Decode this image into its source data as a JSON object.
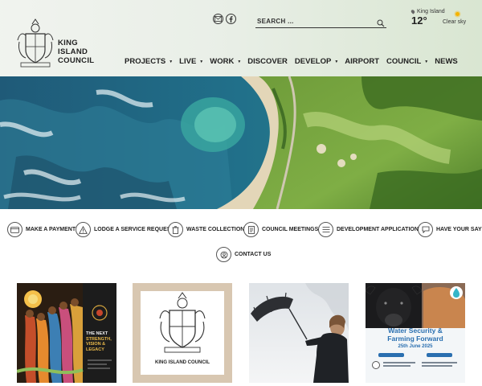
{
  "header": {
    "logo_line1": "KING",
    "logo_line2": "ISLAND",
    "logo_line3": "COUNCIL",
    "social": [
      "email-icon",
      "facebook-icon"
    ],
    "search_label": "SEARCH ...",
    "weather": {
      "location": "King Island",
      "temperature": "12°",
      "condition": "Clear sky"
    }
  },
  "nav": {
    "items": [
      {
        "label": "PROJECTS",
        "dropdown": true
      },
      {
        "label": "LIVE",
        "dropdown": true
      },
      {
        "label": "WORK",
        "dropdown": true
      },
      {
        "label": "DISCOVER",
        "dropdown": false
      },
      {
        "label": "DEVELOP",
        "dropdown": true
      },
      {
        "label": "AIRPORT",
        "dropdown": false
      },
      {
        "label": "COUNCIL",
        "dropdown": true
      },
      {
        "label": "NEWS",
        "dropdown": false
      }
    ]
  },
  "quick_links": [
    {
      "label": "MAKE A PAYMENT",
      "icon": "payment-icon"
    },
    {
      "label": "LODGE A SERVICE REQUEST",
      "icon": "warning-icon"
    },
    {
      "label": "WASTE COLLECTION",
      "icon": "bin-icon"
    },
    {
      "label": "COUNCIL MEETINGS",
      "icon": "document-icon"
    },
    {
      "label": "DEVELOPMENT APPLICATIONS",
      "icon": "applications-icon"
    },
    {
      "label": "HAVE YOUR SAY",
      "icon": "speech-bubble-icon"
    },
    {
      "label": "CONTACT US",
      "icon": "contact-icon"
    }
  ],
  "cards": {
    "card1": {
      "line1": "THE NEXT",
      "line2": "STRENGTH,",
      "line3": "VISION &",
      "line4": "LEGACY"
    },
    "card2": {
      "caption": "KING ISLAND COUNCIL"
    },
    "card4": {
      "title1": "Water Security &",
      "title2": "Farming Forward",
      "date": "25th June 2025"
    }
  },
  "colors": {
    "nav_text": "#222222",
    "accent_blue": "#2a6fb0",
    "card_beige": "#d8c7b1",
    "card_poster_bg": "#1c1c1c"
  }
}
